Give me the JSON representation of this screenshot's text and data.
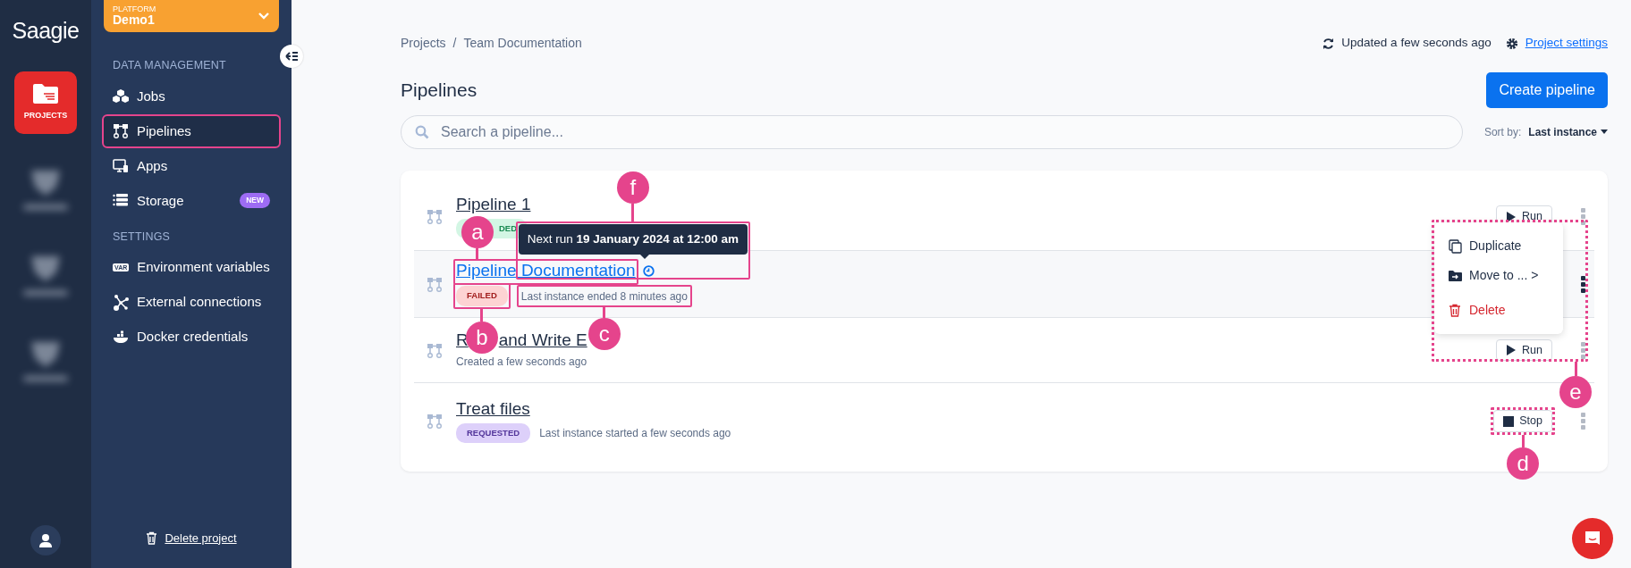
{
  "rail": {
    "logo": "Saagie",
    "items": [
      {
        "label": "PROJECTS",
        "selected": true
      },
      {
        "selected": false
      },
      {
        "selected": false
      },
      {
        "selected": false
      }
    ]
  },
  "platform": {
    "caption": "PLATFORM",
    "name": "Demo1"
  },
  "sidebar": {
    "sections": [
      {
        "title": "DATA MANAGEMENT",
        "items": [
          {
            "label": "Jobs",
            "kind": "jobs",
            "selected": false,
            "highlighted": false
          },
          {
            "label": "Pipelines",
            "kind": "pipelines",
            "selected": true,
            "highlighted": true
          },
          {
            "label": "Apps",
            "kind": "apps",
            "selected": false,
            "highlighted": false
          },
          {
            "label": "Storage",
            "kind": "storage",
            "selected": false,
            "highlighted": false,
            "badge": "NEW"
          }
        ]
      },
      {
        "title": "SETTINGS",
        "items": [
          {
            "label": "Environment variables",
            "kind": "var",
            "icon_text": "VAR",
            "selected": false,
            "highlighted": false
          },
          {
            "label": "External connections",
            "kind": "connections",
            "selected": false,
            "highlighted": false
          },
          {
            "label": "Docker credentials",
            "kind": "docker",
            "selected": false,
            "highlighted": false
          }
        ]
      }
    ]
  },
  "delete_project": "Delete project",
  "breadcrumb": {
    "items": [
      "Projects",
      "Team Documentation"
    ],
    "separator": "/"
  },
  "status": "Updated a few seconds ago",
  "settings_link": "Project settings",
  "title": "Pipelines",
  "create_button": "Create pipeline",
  "search": {
    "placeholder": "Search a pipeline..."
  },
  "sort": {
    "label": "Sort by:",
    "value": "Last instance"
  },
  "pipelines": [
    {
      "name": "Pipeline 1",
      "hovered": false,
      "status": {
        "label": "DED",
        "kind": "success"
      },
      "action": {
        "kind": "run",
        "label": "Run"
      },
      "menu_open": false
    },
    {
      "name": "Pipeline Documentation",
      "hovered": true,
      "scheduled": true,
      "status": {
        "label": "FAILED",
        "kind": "failed"
      },
      "info": "Last instance ended 8 minutes ago",
      "menu_open": true
    },
    {
      "name_visible": [
        "R",
        "and Write E"
      ],
      "hovered": false,
      "info": "Created a few seconds ago",
      "action": {
        "kind": "run",
        "label": "Run"
      },
      "menu_open": false
    },
    {
      "name": "Treat files",
      "hovered": false,
      "status": {
        "label": "REQUESTED",
        "kind": "requested"
      },
      "info": "Last instance started a few seconds ago",
      "action": {
        "kind": "stop",
        "label": "Stop"
      },
      "menu_open": false
    }
  ],
  "tooltip": "Next run **19 January 2024 at 12:00 am**",
  "context_menu": [
    {
      "label": "Duplicate",
      "kind": "duplicate"
    },
    {
      "label": "Move to ... >",
      "kind": "move"
    },
    {
      "label": "Delete",
      "kind": "delete"
    }
  ],
  "callouts": [
    {
      "label": "a"
    },
    {
      "label": "b"
    },
    {
      "label": "c"
    },
    {
      "label": "d"
    },
    {
      "label": "e"
    },
    {
      "label": "f"
    }
  ]
}
